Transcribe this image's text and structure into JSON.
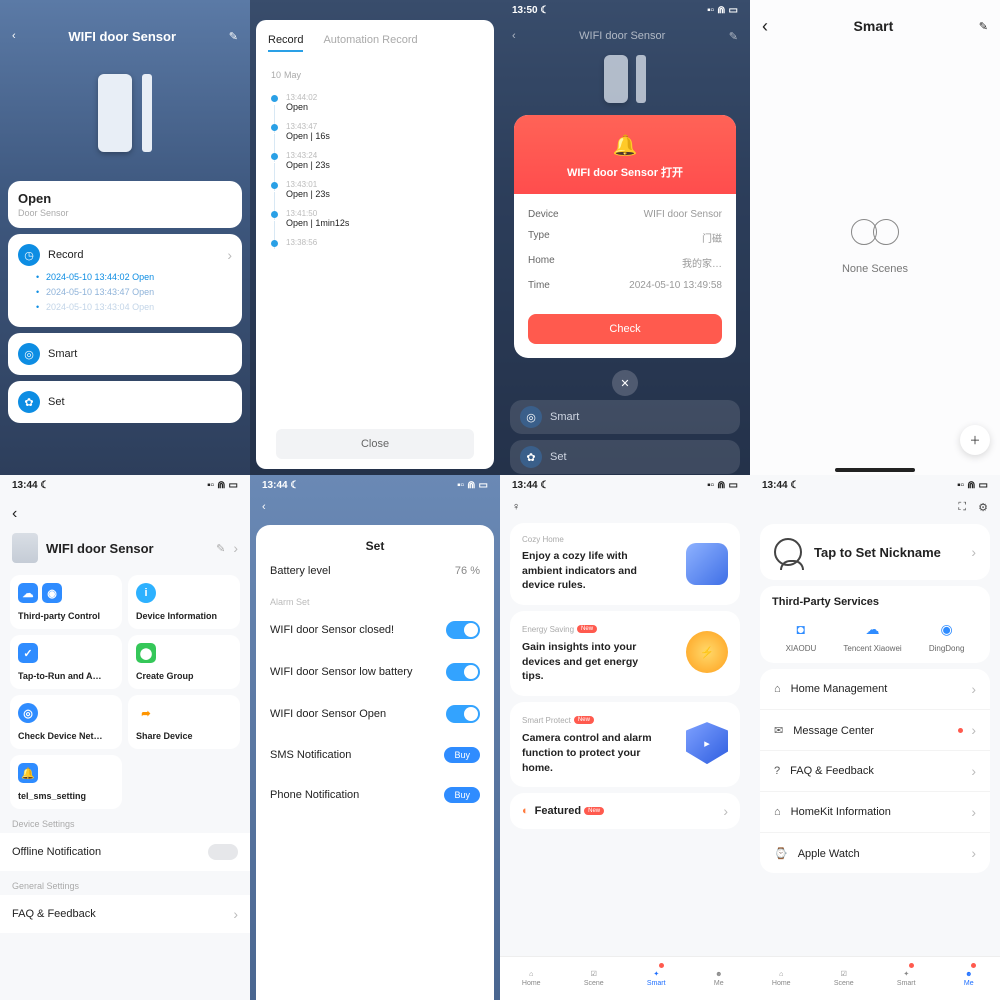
{
  "status": {
    "time1350": "13:50",
    "time1344": "13:44",
    "moon": "☾",
    "sig": "▪▫",
    "wifi": "⋒",
    "batt": "▭"
  },
  "s1": {
    "title": "WIFI door Sensor",
    "state": "Open",
    "subtitle": "Door Sensor",
    "record": "Record",
    "records": [
      "2024-05-10 13:44:02 Open",
      "2024-05-10 13:43:47 Open",
      "2024-05-10 13:43:04 Open"
    ],
    "smart": "Smart",
    "set": "Set"
  },
  "s2": {
    "tab_record": "Record",
    "tab_auto": "Automation Record",
    "day": "10",
    "month": "May",
    "events": [
      {
        "t": "13:44:02",
        "s": "Open"
      },
      {
        "t": "13:43:47",
        "s": "Open  |  16s"
      },
      {
        "t": "13:43:24",
        "s": "Open  |  23s"
      },
      {
        "t": "13:43:01",
        "s": "Open  |  23s"
      },
      {
        "t": "13:41:50",
        "s": "Open  |  1min12s"
      },
      {
        "t": "13:38:56",
        "s": ""
      }
    ],
    "close": "Close"
  },
  "s3": {
    "title": "WIFI door Sensor",
    "alert_title": "WIFI door Sensor 打开",
    "rows": {
      "device_k": "Device",
      "device_v": "WIFI door Sensor",
      "type_k": "Type",
      "type_v": "门磁",
      "home_k": "Home",
      "home_v": "我的家…",
      "time_k": "Time",
      "time_v": "2024-05-10 13:49:58"
    },
    "check": "Check",
    "smart": "Smart",
    "set": "Set"
  },
  "s4": {
    "title": "Smart",
    "none": "None Scenes"
  },
  "s5": {
    "time": "13:44",
    "title": "WIFI door Sensor",
    "tiles": [
      "Third-party Control",
      "Device Information",
      "Tap-to-Run and A…",
      "Create Group",
      "Check Device Net…",
      "Share Device",
      "tel_sms_setting"
    ],
    "dev_settings": "Device Settings",
    "offline": "Offline Notification",
    "gen_settings": "General Settings",
    "faq": "FAQ & Feedback"
  },
  "s6": {
    "title": "Set",
    "battery_k": "Battery level",
    "battery_v": "76 %",
    "alarm_set": "Alarm Set",
    "rows": [
      "WIFI door Sensor closed!",
      "WIFI door Sensor low battery",
      "WIFI door Sensor Open"
    ],
    "sms": "SMS Notification",
    "phone": "Phone Notification",
    "buy": "Buy"
  },
  "s7": {
    "cards": [
      {
        "lbl": "Cozy Home",
        "txt": "Enjoy a cozy life with ambient indicators and device rules.",
        "new": false,
        "color": "#5b8cff"
      },
      {
        "lbl": "Energy Saving",
        "txt": "Gain insights into your devices and get energy tips.",
        "new": true,
        "color": "#ffb02e"
      },
      {
        "lbl": "Smart Protect",
        "txt": "Camera control and alarm function to protect your home.",
        "new": true,
        "color": "#4a7af0"
      }
    ],
    "featured": "Featured",
    "nav": [
      "Home",
      "Scene",
      "Smart",
      "Me"
    ],
    "active": "Smart"
  },
  "s8": {
    "nick": "Tap to Set Nickname",
    "tp_title": "Third-Party Services",
    "tps": [
      "XIAODU",
      "Tencent Xiaowei",
      "DingDong"
    ],
    "rows": [
      "Home Management",
      "Message Center",
      "FAQ & Feedback",
      "HomeKit Information",
      "Apple Watch"
    ],
    "nav": [
      "Home",
      "Scene",
      "Smart",
      "Me"
    ],
    "active": "Me"
  }
}
